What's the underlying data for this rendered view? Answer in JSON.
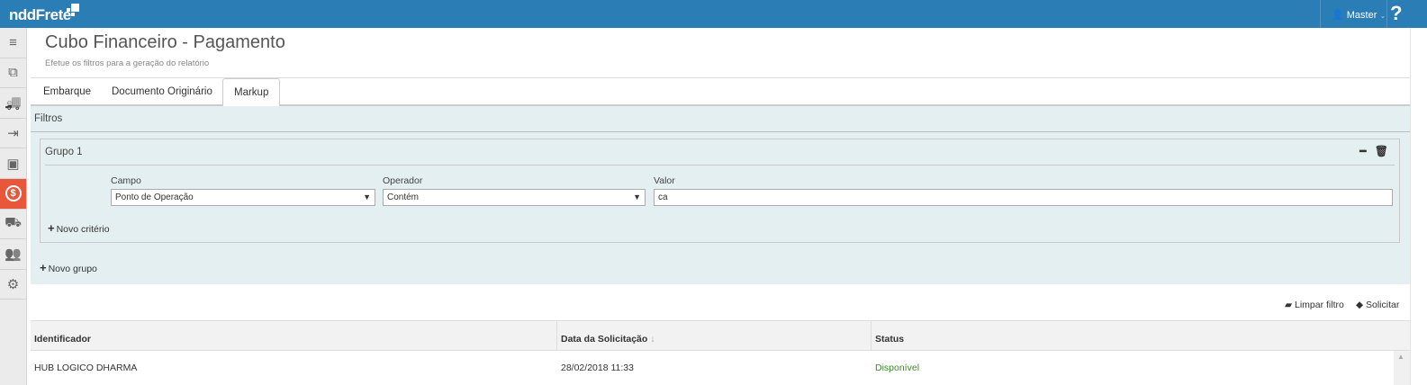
{
  "header": {
    "logo": "nddFrete",
    "user": "Master",
    "help": "?"
  },
  "sidebar": {
    "items": [
      {
        "icon": "menu-icon",
        "g": "≡"
      },
      {
        "icon": "documents-icon",
        "g": "⧉"
      },
      {
        "icon": "truck-icon",
        "g": "🚚"
      },
      {
        "icon": "export-icon",
        "g": "⇥"
      },
      {
        "icon": "money-icon",
        "g": "▣"
      },
      {
        "icon": "payment-cycle-icon",
        "g": "$"
      },
      {
        "icon": "truck-delivery-icon",
        "g": "⛟"
      },
      {
        "icon": "users-icon",
        "g": "👥"
      },
      {
        "icon": "settings-icon",
        "g": "⚙"
      }
    ]
  },
  "page": {
    "title": "Cubo Financeiro - Pagamento",
    "subtitle": "Efetue os filtros para a geração do relatório"
  },
  "tabs": [
    "Embarque",
    "Documento Originário",
    "Markup"
  ],
  "filters": {
    "title": "Filtros",
    "group": {
      "title": "Grupo 1",
      "fields": {
        "campo_label": "Campo",
        "campo_value": "Ponto de Operação",
        "operador_label": "Operador",
        "operador_value": "Contém",
        "valor_label": "Valor",
        "valor_value": "ca"
      },
      "add_criterion": "Novo critério"
    },
    "add_group": "Novo grupo"
  },
  "actions": {
    "clear": "Limpar filtro",
    "request": "Solicitar"
  },
  "table": {
    "columns": [
      "Identificador",
      "Data da Solicitação",
      "Status"
    ],
    "sort_indicator": "↓",
    "rows": [
      {
        "id": "HUB LOGICO DHARMA",
        "date": "28/02/2018 11:33",
        "status": "Disponível"
      }
    ]
  },
  "colors": {
    "brand": "#2a7db5",
    "active": "#e8573a",
    "status_ok": "#3a8a2a"
  }
}
